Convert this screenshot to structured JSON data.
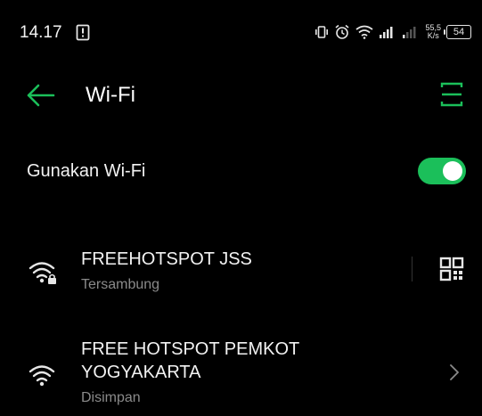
{
  "status_bar": {
    "time": "14.17",
    "speed_value": "55,5",
    "speed_unit": "K/s",
    "battery": "54"
  },
  "header": {
    "title": "Wi-Fi"
  },
  "wifi_toggle": {
    "label": "Gunakan Wi-Fi",
    "on": true
  },
  "networks": [
    {
      "name": "FREEHOTSPOT JSS",
      "status": "Tersambung",
      "secured": true,
      "action": "qr-code-icon"
    },
    {
      "name_line1": "FREE HOTSPOT PEMKOT",
      "name_line2": "YOGYAKARTA",
      "status": "Disimpan",
      "secured": false,
      "action": "chevron-right-icon"
    }
  ],
  "colors": {
    "accent": "#1bbf5a",
    "background": "#000000",
    "secondary_text": "#8a8a8a"
  }
}
